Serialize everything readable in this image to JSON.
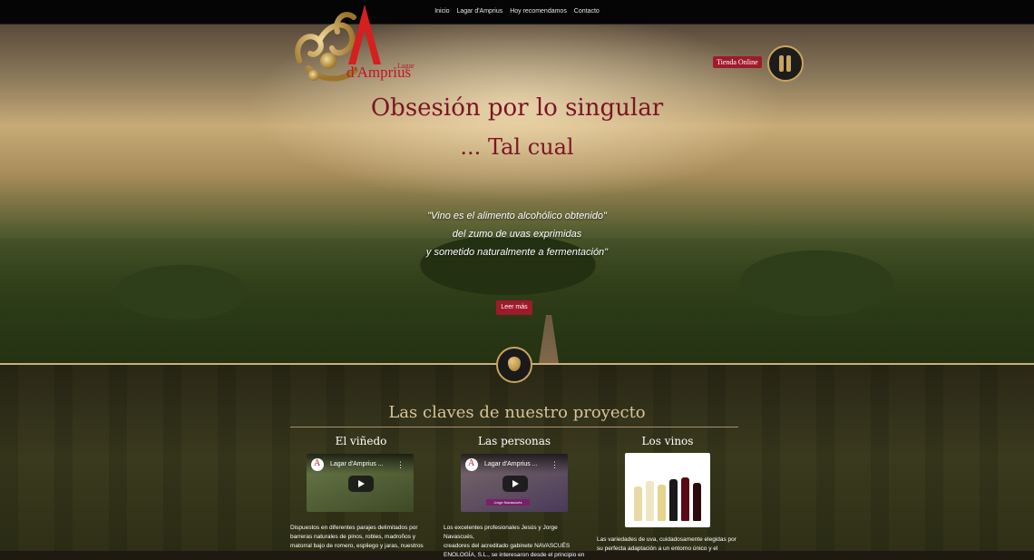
{
  "nav": {
    "items": [
      "Inicio",
      "Lagar d'Amprius",
      "Hoy recomendamos",
      "Contacto"
    ]
  },
  "logo": {
    "line1": "Lagar",
    "line2": "d'Amprius"
  },
  "shop": {
    "label": "Tienda Online"
  },
  "hero": {
    "title": "Obsesión por lo singular",
    "subtitle": "... Tal cual",
    "quote_lines": [
      "\"Vino es el alimento alcohólico obtenido\"",
      "del zumo de uvas exprimidas",
      "y sometido naturalmente a fermentación\""
    ],
    "button": "Leer más"
  },
  "section": {
    "title": "Las claves de nuestro proyecto",
    "columns": [
      {
        "title": "El viñedo",
        "video_title": "Lagar d'Amprius ...",
        "text_lines": [
          "Dispuestos en diferentes parajes delimitados por",
          "barreras naturales de pinos, robles, madroños y",
          "matorral bajo de romero, espliego y jaras, nuestros"
        ]
      },
      {
        "title": "Las personas",
        "video_title": "Lagar d'Amprius ...",
        "video_caption": "Jorge Navascués",
        "text_lines": [
          "Los excelentes profesionales Jesús y Jorge Navascués,",
          "creadores del acreditado gabinete NAVASCUÉS",
          "ENOLOGÍA, S.L., se interesaron desde el principio en"
        ]
      },
      {
        "title": "Los vinos",
        "text_lines": [
          "Las variedades de uva, cuidadosamente elegidas por",
          "su perfecta adaptación a un entorno único y el"
        ]
      }
    ]
  },
  "colors": {
    "accent": "#9e1b2b",
    "gold": "#c9a45c",
    "title_red": "#7a1525"
  }
}
